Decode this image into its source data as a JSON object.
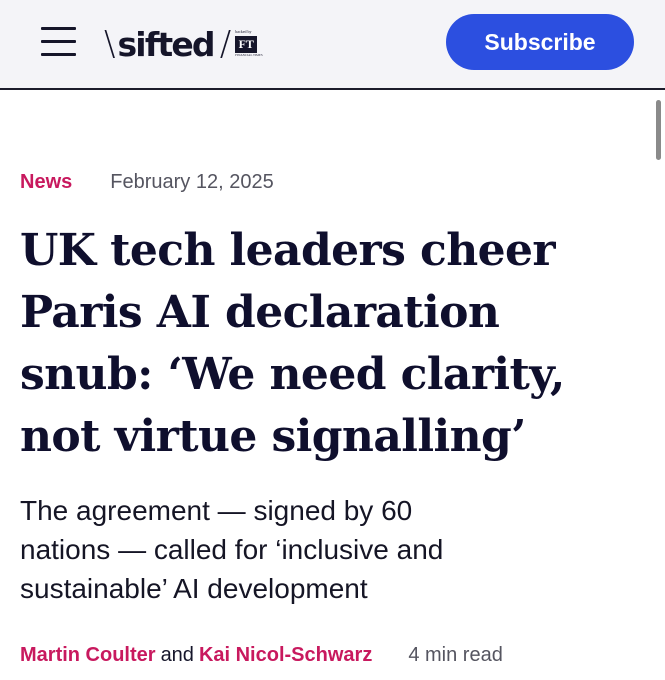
{
  "header": {
    "menu_icon": "hamburger-menu-icon",
    "logo": {
      "slash": "\\",
      "wordmark": "sifted",
      "divider": "/",
      "backed_by": "backed by",
      "ft_mark": "FT",
      "ft_name": "FINANCIAL TIMES"
    },
    "subscribe_label": "Subscribe",
    "subscribe_color": "#2c4fe0",
    "background_color": "#f4f4f8"
  },
  "article": {
    "category": "News",
    "category_color": "#c8195e",
    "date": "February 12, 2025",
    "headline": "UK tech leaders cheer Paris AI declaration snub: ‘We need clarity, not virtue signalling’",
    "subheadline": "The agreement — signed by 60 nations — called for ‘inclusive and sustainable’ AI development",
    "byline": {
      "authors": [
        "Martin Coulter",
        "Kai Nicol-Schwarz"
      ],
      "conjunction": "and",
      "read_time": "4 min read"
    }
  }
}
